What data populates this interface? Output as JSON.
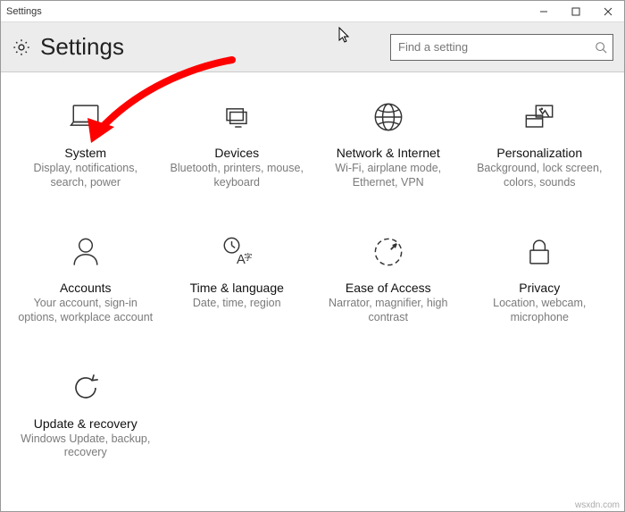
{
  "window": {
    "title": "Settings"
  },
  "header": {
    "appTitle": "Settings",
    "search": {
      "placeholder": "Find a setting"
    }
  },
  "tiles": {
    "system": {
      "title": "System",
      "desc": "Display, notifications, search, power"
    },
    "devices": {
      "title": "Devices",
      "desc": "Bluetooth, printers, mouse, keyboard"
    },
    "network": {
      "title": "Network & Internet",
      "desc": "Wi-Fi, airplane mode, Ethernet, VPN"
    },
    "personalize": {
      "title": "Personalization",
      "desc": "Background, lock screen, colors, sounds"
    },
    "accounts": {
      "title": "Accounts",
      "desc": "Your account, sign-in options, workplace account"
    },
    "timelang": {
      "title": "Time & language",
      "desc": "Date, time, region"
    },
    "ease": {
      "title": "Ease of Access",
      "desc": "Narrator, magnifier, high contrast"
    },
    "privacy": {
      "title": "Privacy",
      "desc": "Location, webcam, microphone"
    },
    "update": {
      "title": "Update & recovery",
      "desc": "Windows Update, backup, recovery"
    }
  },
  "watermark": "wsxdn.com"
}
